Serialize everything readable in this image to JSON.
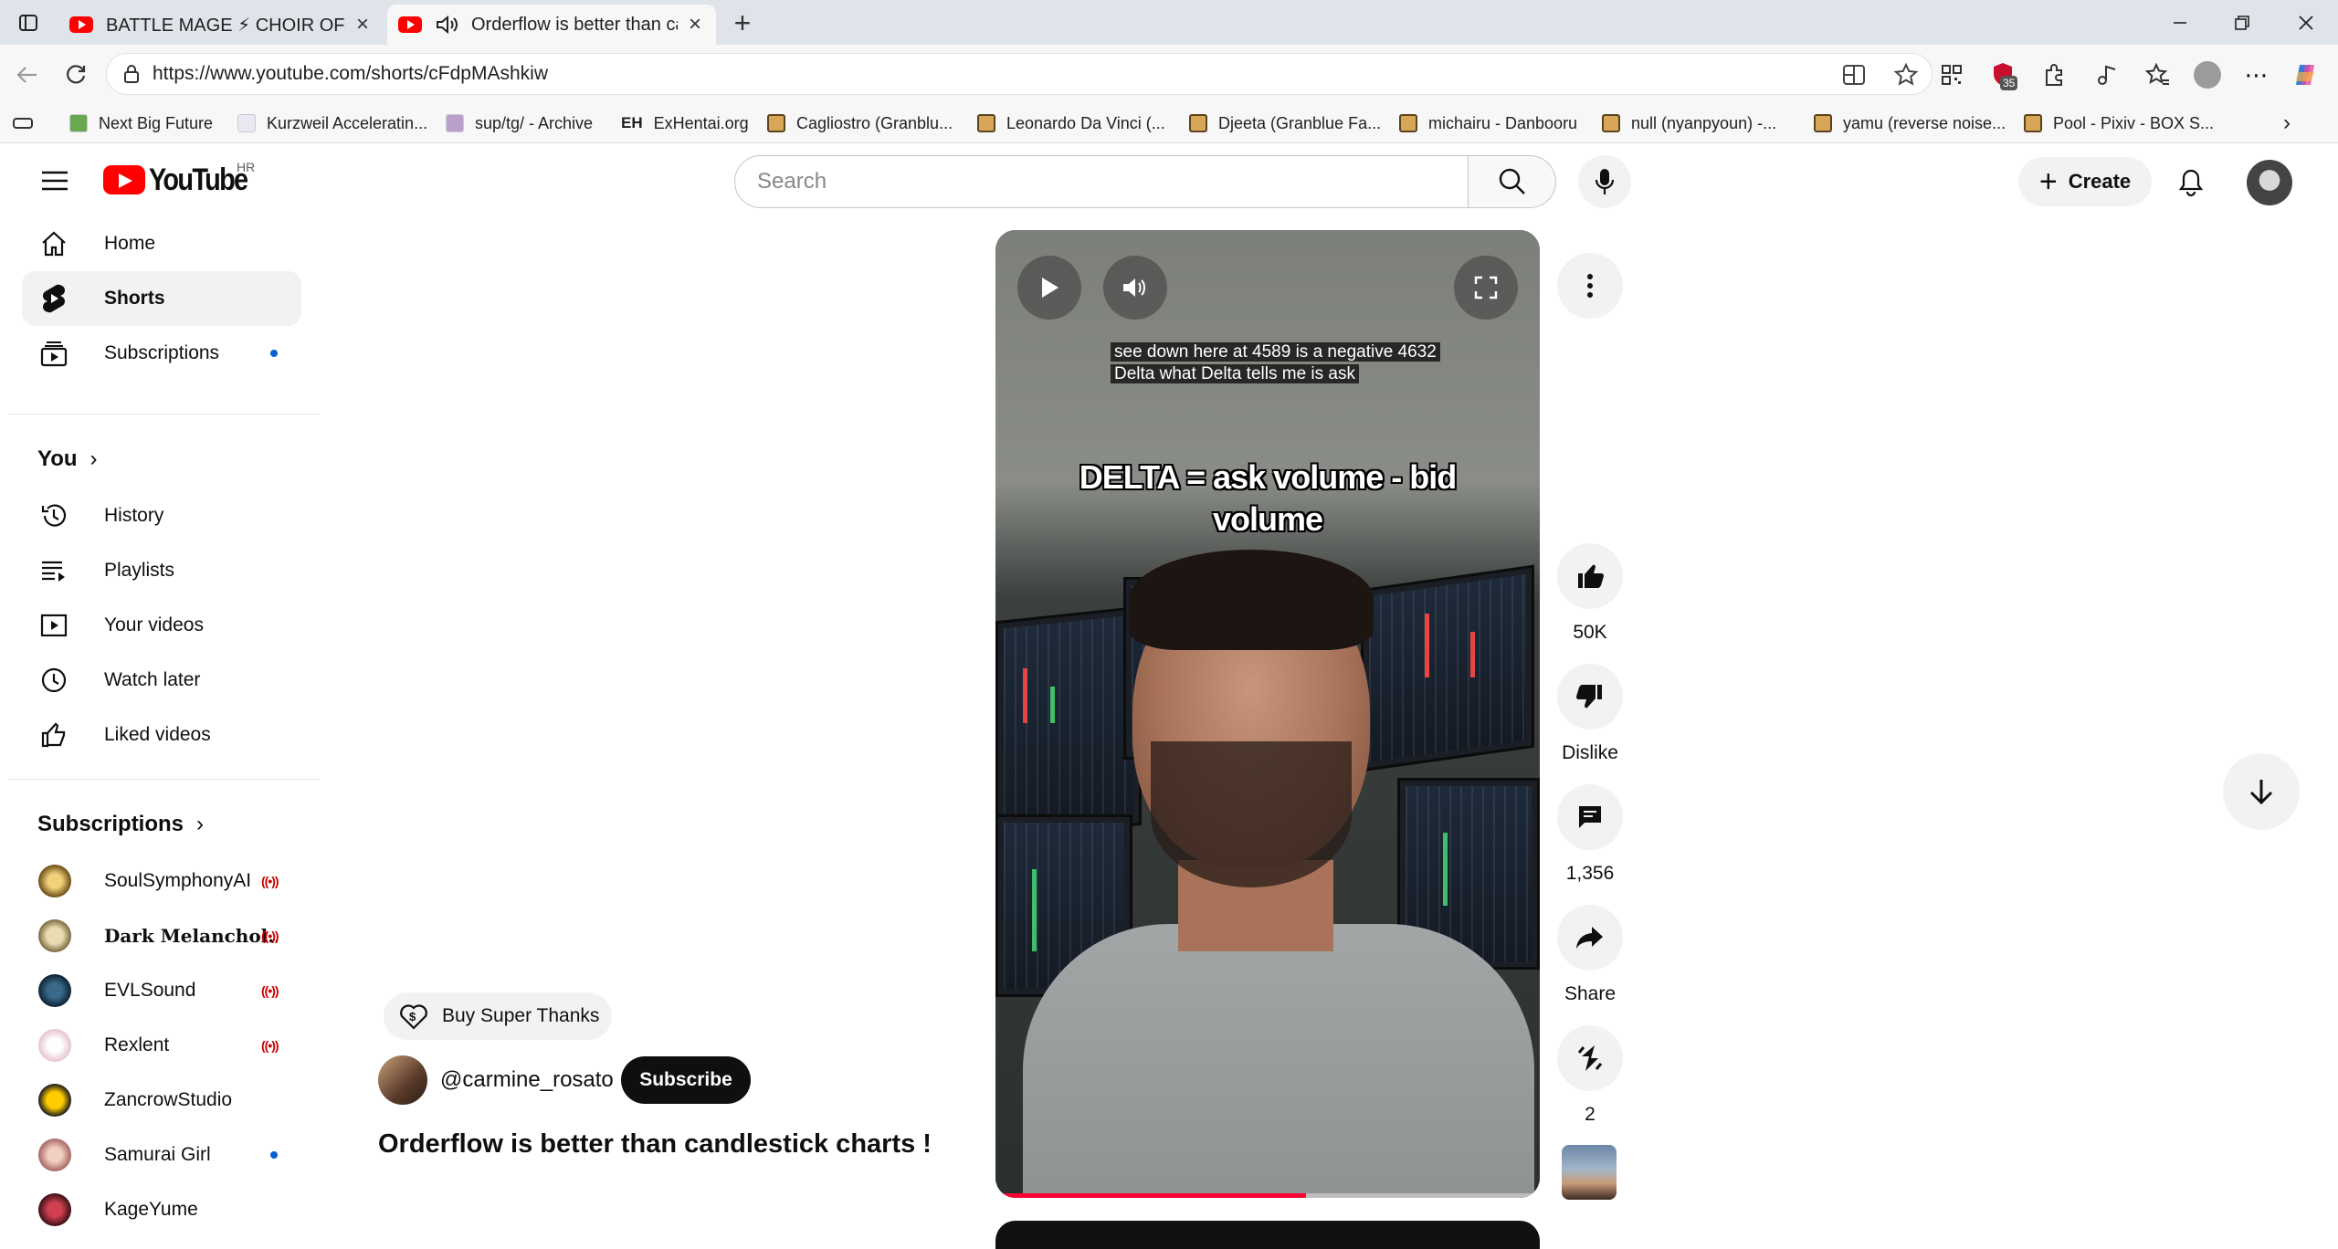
{
  "browser": {
    "tabs": [
      {
        "title": "BATTLE MAGE ⚡ CHOIR OF SPELLS",
        "active": false
      },
      {
        "title": "Orderflow is better than candlestick charts !",
        "active": true
      }
    ],
    "new_tab": "+",
    "url": "https://www.youtube.com/shorts/cFdpMAshkiw",
    "extension_badge": "35",
    "bookmarks": [
      {
        "label": "Next Big Future",
        "icon": "page"
      },
      {
        "label": "Kurzweil Acceleratin...",
        "icon": "page"
      },
      {
        "label": "sup/tg/ - Archive",
        "icon": "page"
      },
      {
        "label": "ExHentai.org",
        "icon": "page"
      },
      {
        "label": "Cagliostro (Granblu...",
        "icon": "folder"
      },
      {
        "label": "Leonardo Da Vinci (...",
        "icon": "folder"
      },
      {
        "label": "Djeeta (Granblue Fa...",
        "icon": "folder"
      },
      {
        "label": "michairu - Danbooru",
        "icon": "folder"
      },
      {
        "label": "null (nyanpyoun) -...",
        "icon": "folder"
      },
      {
        "label": "yamu (reverse noise...",
        "icon": "folder"
      },
      {
        "label": "Pool - Pixiv - BOX S...",
        "icon": "folder"
      }
    ]
  },
  "youtube": {
    "logo_text": "YouTube",
    "country_code": "HR",
    "search_placeholder": "Search",
    "create_label": "Create",
    "sidebar": {
      "main": [
        {
          "label": "Home",
          "icon": "home-icon",
          "selected": false
        },
        {
          "label": "Shorts",
          "icon": "shorts-icon",
          "selected": true
        },
        {
          "label": "Subscriptions",
          "icon": "subscriptions-icon",
          "selected": false,
          "dot": true
        }
      ],
      "you_heading": "You",
      "you": [
        {
          "label": "History",
          "icon": "history-icon"
        },
        {
          "label": "Playlists",
          "icon": "playlists-icon"
        },
        {
          "label": "Your videos",
          "icon": "your-videos-icon"
        },
        {
          "label": "Watch later",
          "icon": "watch-later-icon"
        },
        {
          "label": "Liked videos",
          "icon": "liked-videos-icon"
        }
      ],
      "subs_heading": "Subscriptions",
      "subscriptions": [
        {
          "label": "SoulSymphonyAI",
          "status": "live",
          "color": "#8a6a2a"
        },
        {
          "label": "Dark Melanchol...",
          "status": "live",
          "color": "#b8a77a"
        },
        {
          "label": "EVLSound",
          "status": "live",
          "color": "#14304a"
        },
        {
          "label": "Rexlent",
          "status": "live",
          "color": "#e9d2d6"
        },
        {
          "label": "ZancrowStudio",
          "status": "none",
          "color": "#e0b000"
        },
        {
          "label": "Samurai Girl",
          "status": "new",
          "color": "#c98a8a"
        },
        {
          "label": "KageYume",
          "status": "none",
          "color": "#7a1020"
        }
      ]
    },
    "short": {
      "buy_super_thanks": "Buy Super Thanks",
      "channel_handle": "@carmine_rosato",
      "subscribe_label": "Subscribe",
      "title": "Orderflow is better than candlestick charts !",
      "caption_lines": [
        "see down here at 4589 is a negative 4632",
        "Delta what Delta tells me is ask"
      ],
      "overlay_lines": [
        "DELTA = ask volume - bid",
        "volume"
      ],
      "progress_fraction": 0.57,
      "likes": "50K",
      "dislike_label": "Dislike",
      "comments": "1,356",
      "share_label": "Share",
      "remix_count": "2"
    }
  }
}
